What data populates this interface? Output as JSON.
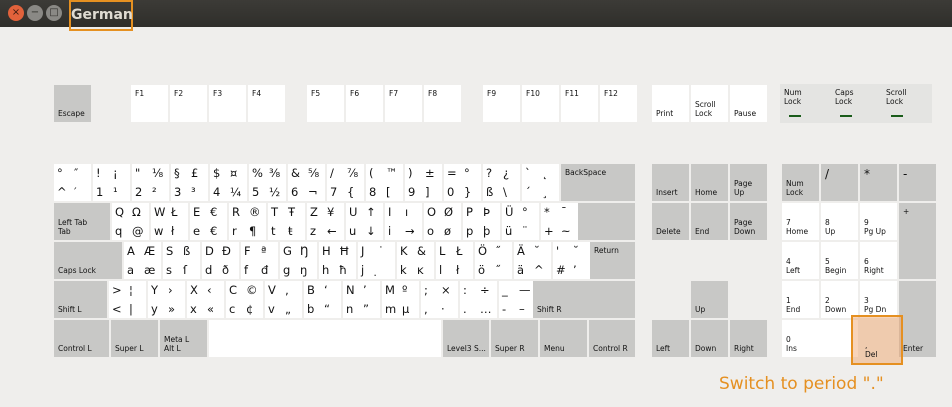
{
  "window": {
    "title": "German",
    "close": "×",
    "minimize": "−",
    "maximize": "□"
  },
  "hint": "Switch to period \".\"",
  "keys": {
    "esc": "Escape",
    "f1": "F1",
    "f2": "F2",
    "f3": "F3",
    "f4": "F4",
    "f5": "F5",
    "f6": "F6",
    "f7": "F7",
    "f8": "F8",
    "f9": "F9",
    "f10": "F10",
    "f11": "F11",
    "f12": "F12",
    "print": "Print",
    "scroll": "Scroll\nLock",
    "pause": "Pause",
    "numlock_led": "Num\nLock",
    "capslock_led": "Caps\nLock",
    "scrolllock_led": "Scroll\nLock",
    "backspace": "BackSpace",
    "tab": "Left Tab\nTab",
    "return": "Return",
    "capslock": "Caps Lock",
    "shiftl": "Shift L",
    "shiftr": "Shift R",
    "controll": "Control L",
    "superl": "Super L",
    "meta": "Meta L\nAlt L",
    "level3": "Level3 S...",
    "superr": "Super R",
    "menu": "Menu",
    "controlr": "Control R",
    "insert": "Insert",
    "home": "Home",
    "pgup": "Page\nUp",
    "delete": "Delete",
    "end": "End",
    "pgdn": "Page\nDown",
    "up": "Up",
    "left": "Left",
    "down": "Down",
    "right": "Right",
    "kp_numlock": "Num\nLock",
    "kp_div": "/",
    "kp_mul": "*",
    "kp_minus": "-",
    "kp_plus": "+",
    "kp_enter": "Enter",
    "kp7": "7\nHome",
    "kp8": "8\nUp",
    "kp9": "9\nPg Up",
    "kp4": "4\nLeft",
    "kp5": "5\nBegin",
    "kp6": "6\nRight",
    "kp1": "1\nEnd",
    "kp2": "2\nDown",
    "kp3": "3\nPg Dn",
    "kp0": "0\nIns",
    "kpdel": ",\nDel"
  },
  "glyphs": {
    "k_grave": [
      "°",
      "″",
      "^",
      "′"
    ],
    "k_1": [
      "!",
      "¡",
      "1",
      "¹"
    ],
    "k_2": [
      "\"",
      "⅛",
      "2",
      "²"
    ],
    "k_3": [
      "§",
      "£",
      "3",
      "³"
    ],
    "k_4": [
      "$",
      "¤",
      "4",
      "¼"
    ],
    "k_5": [
      "%",
      "⅜",
      "5",
      "½"
    ],
    "k_6": [
      "&",
      "⅝",
      "6",
      "¬"
    ],
    "k_7": [
      "/",
      "⅞",
      "7",
      "{"
    ],
    "k_8": [
      "(",
      "™",
      "8",
      "["
    ],
    "k_9": [
      ")",
      "±",
      "9",
      "]"
    ],
    "k_0": [
      "=",
      "°",
      "0",
      "}"
    ],
    "k_ss": [
      "?",
      "¿",
      "ß",
      "\\"
    ],
    "k_acute": [
      "`",
      "˛",
      "´",
      "¸"
    ],
    "k_q": [
      "Q",
      "Ω",
      "q",
      "@"
    ],
    "k_w": [
      "W",
      "Ł",
      "w",
      "ł"
    ],
    "k_e": [
      "E",
      "€",
      "e",
      "€"
    ],
    "k_r": [
      "R",
      "®",
      "r",
      "¶"
    ],
    "k_t": [
      "T",
      "Ŧ",
      "t",
      "ŧ"
    ],
    "k_z": [
      "Z",
      "¥",
      "z",
      "←"
    ],
    "k_u": [
      "U",
      "↑",
      "u",
      "↓"
    ],
    "k_i": [
      "I",
      "ı",
      "i",
      "→"
    ],
    "k_o": [
      "O",
      "Ø",
      "o",
      "ø"
    ],
    "k_p": [
      "P",
      "Þ",
      "p",
      "þ"
    ],
    "k_ue": [
      "Ü",
      "°",
      "ü",
      "¨"
    ],
    "k_plus": [
      "*",
      "¯",
      "+",
      "~"
    ],
    "k_a": [
      "A",
      "Æ",
      "a",
      "æ"
    ],
    "k_s": [
      "S",
      "ß",
      "s",
      "ſ"
    ],
    "k_d": [
      "D",
      "Ð",
      "d",
      "ð"
    ],
    "k_f": [
      "F",
      "ª",
      "f",
      "đ"
    ],
    "k_g": [
      "G",
      "Ŋ",
      "g",
      "ŋ"
    ],
    "k_h": [
      "H",
      "Ħ",
      "h",
      "ħ"
    ],
    "k_j": [
      "J",
      "˙",
      "j",
      "̣"
    ],
    "k_k": [
      "K",
      "&",
      "k",
      "ĸ"
    ],
    "k_l": [
      "L",
      "Ł",
      "l",
      "ł"
    ],
    "k_oe": [
      "Ö",
      "˝",
      "ö",
      "˝"
    ],
    "k_ae": [
      "Ä",
      "˘",
      "ä",
      "^"
    ],
    "k_hash": [
      "'",
      "˘",
      "#",
      "’"
    ],
    "k_lt": [
      ">",
      "¦",
      "<",
      "|"
    ],
    "k_y": [
      "Y",
      "›",
      "y",
      "»"
    ],
    "k_x": [
      "X",
      "‹",
      "x",
      "«"
    ],
    "k_c": [
      "C",
      "©",
      "c",
      "¢"
    ],
    "k_v": [
      "V",
      "‚",
      "v",
      "„"
    ],
    "k_b": [
      "B",
      "‘",
      "b",
      "“"
    ],
    "k_n": [
      "N",
      "’",
      "n",
      "”"
    ],
    "k_m": [
      "M",
      "º",
      "m",
      "µ"
    ],
    "k_comma": [
      ";",
      "×",
      ",",
      "·"
    ],
    "k_period": [
      ":",
      "÷",
      ".",
      "…"
    ],
    "k_minus": [
      "_",
      "—",
      "-",
      "–"
    ]
  }
}
